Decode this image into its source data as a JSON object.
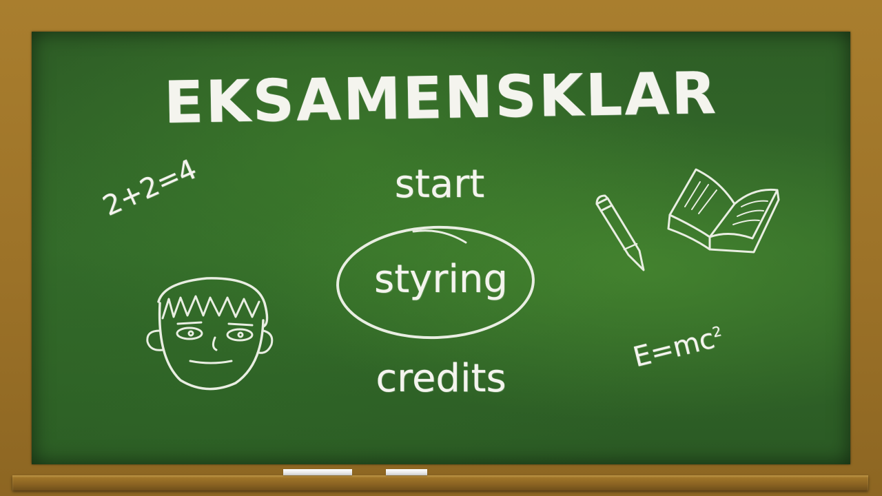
{
  "screen": "main-menu",
  "title": "EKSAMENSKLAR",
  "menu": {
    "start": "start",
    "styring": "styring",
    "credits": "credits",
    "selected": "styring"
  },
  "doodles": {
    "formula_left": "2+2=4",
    "formula_right_base": "E=mc",
    "formula_right_exponent": "2",
    "icons": [
      "boy-face-icon",
      "pencil-icon",
      "open-book-icon"
    ]
  },
  "colors": {
    "frame": "#a0782c",
    "board": "#336a2a",
    "chalk": "#f4f4ee"
  }
}
